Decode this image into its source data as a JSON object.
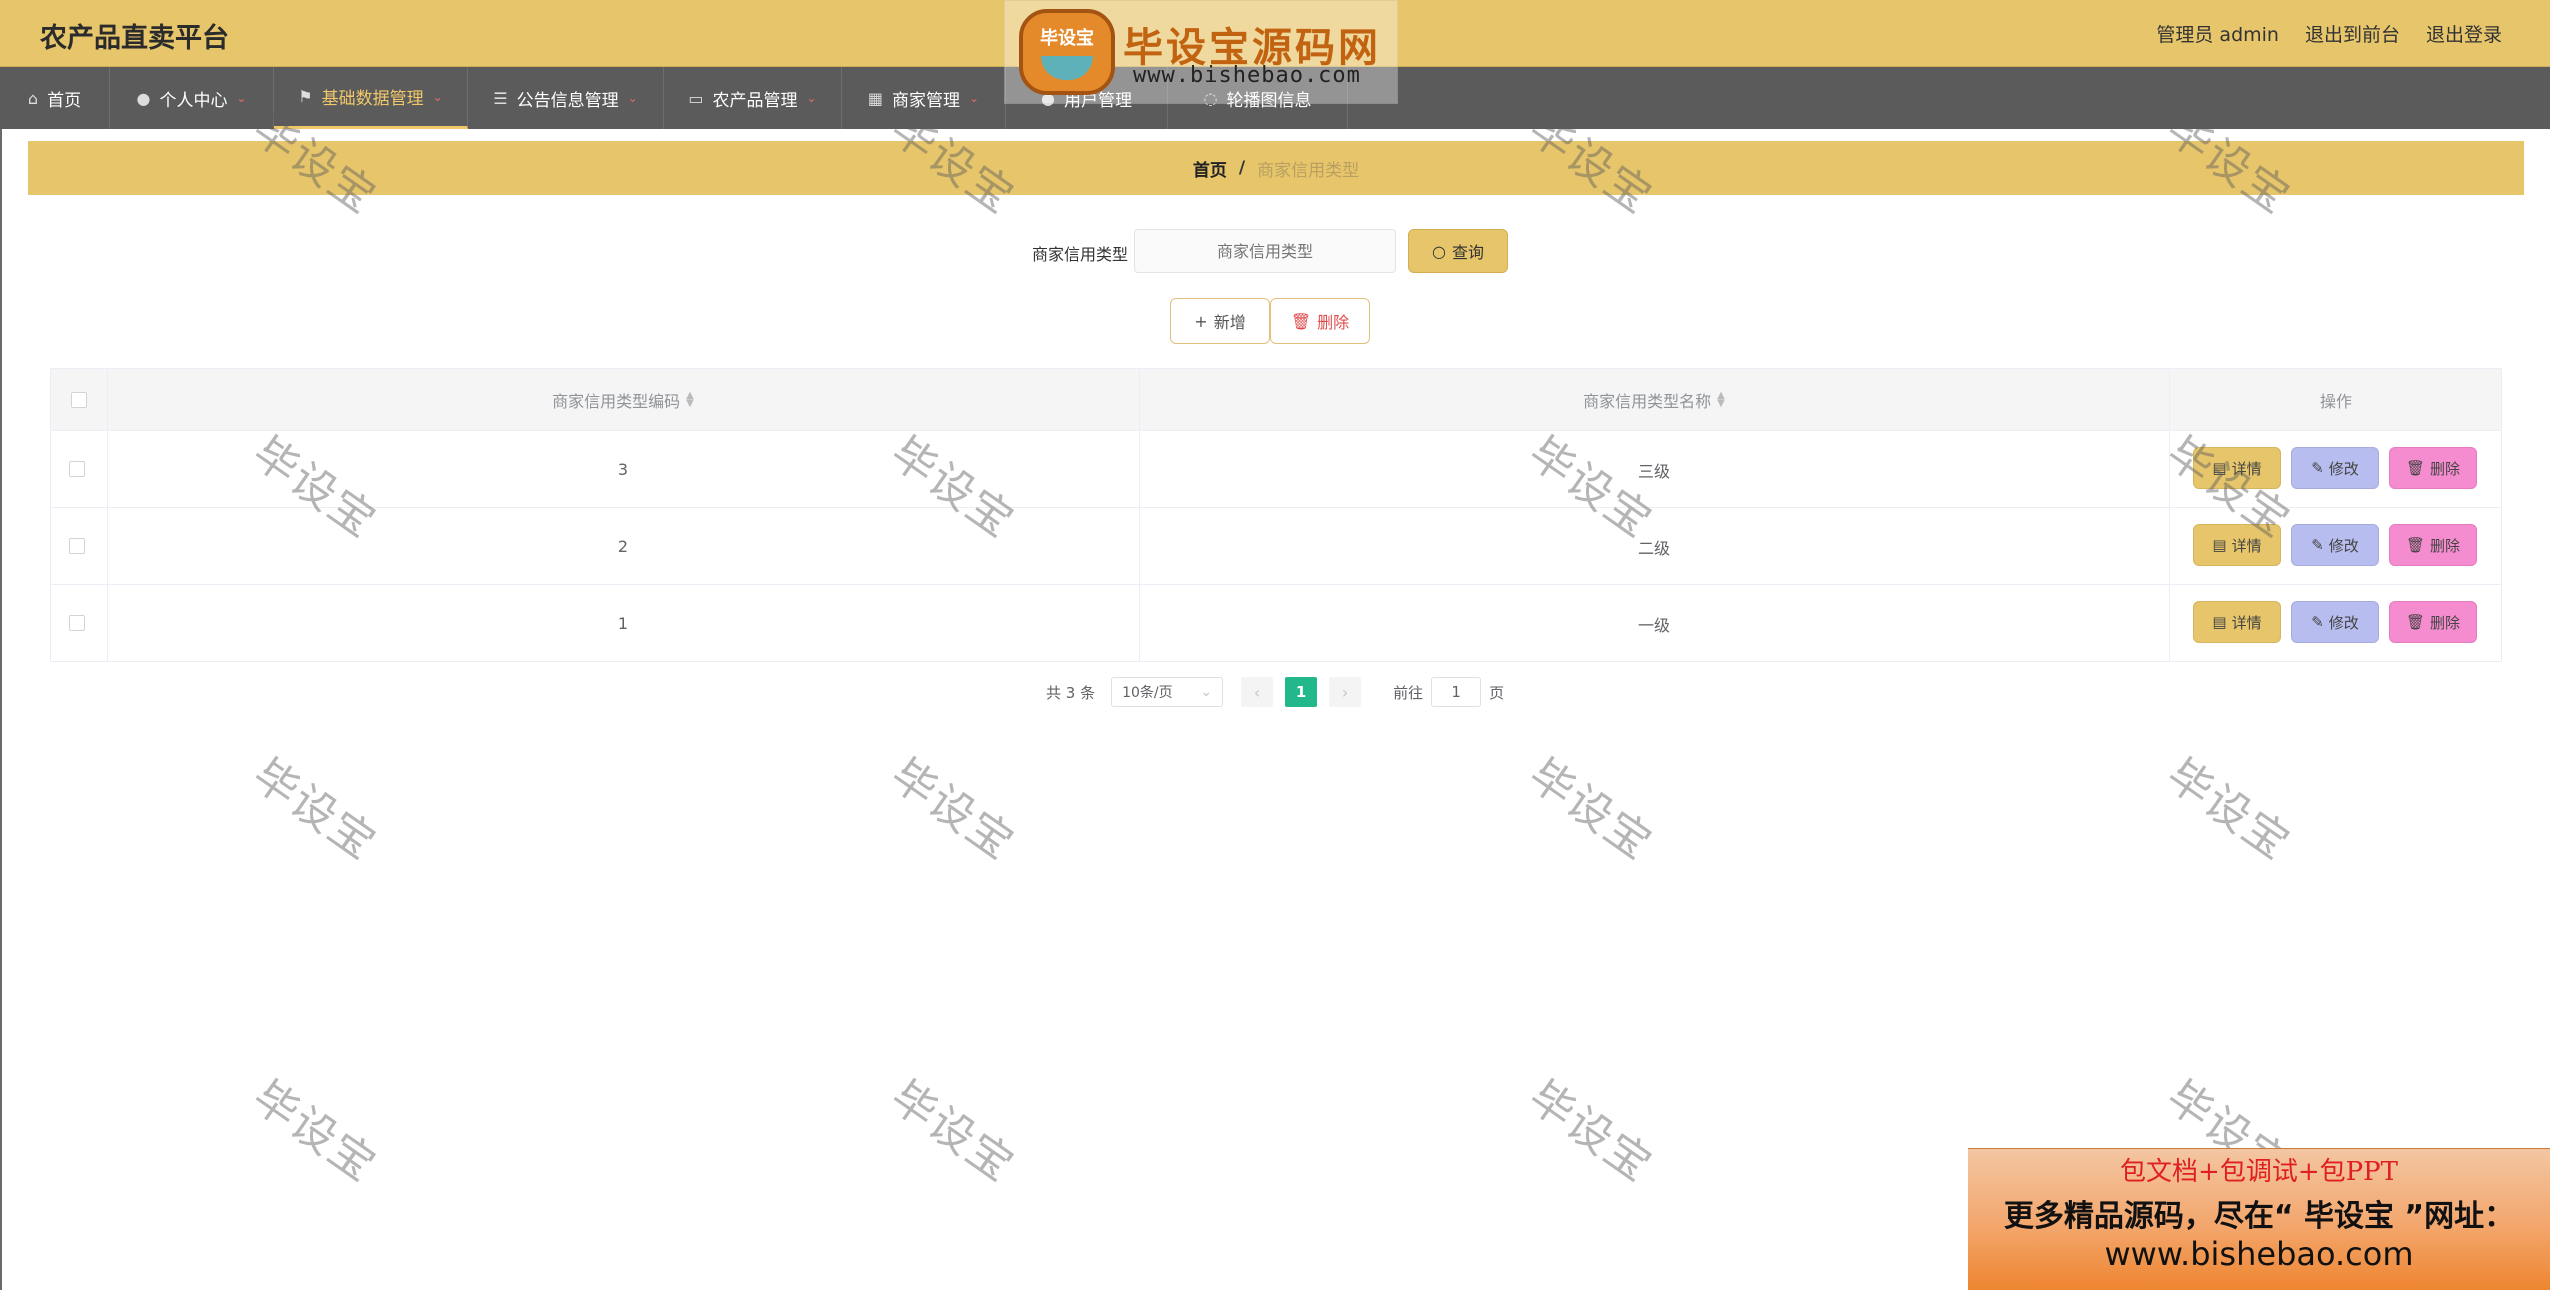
{
  "app": {
    "title": "农产品直卖平台"
  },
  "top_right": {
    "user_label": "管理员 admin",
    "front_link": "退出到前台",
    "logout_link": "退出登录"
  },
  "nav": {
    "items": [
      {
        "label": "首页",
        "icon": "home-icon",
        "active": false
      },
      {
        "label": "个人中心",
        "icon": "user-icon",
        "active": false
      },
      {
        "label": "基础数据管理",
        "icon": "flag-icon",
        "active": true
      },
      {
        "label": "公告信息管理",
        "icon": "sliders-icon",
        "active": false
      },
      {
        "label": "农产品管理",
        "icon": "chat-icon",
        "active": false
      },
      {
        "label": "商家管理",
        "icon": "grid-icon",
        "active": false
      },
      {
        "label": "用户管理",
        "icon": "user-group-icon",
        "active": false
      },
      {
        "label": "轮播图信息",
        "icon": "info-icon",
        "active": false
      }
    ]
  },
  "logo_overlay": {
    "mascot_text": "毕设宝",
    "title": "毕设宝源码网",
    "url": "www.bishebao.com"
  },
  "breadcrumb": {
    "home": "首页",
    "separator": "/",
    "current": "商家信用类型"
  },
  "search": {
    "label": "商家信用类型",
    "placeholder": "商家信用类型",
    "query_button": "查询"
  },
  "toolbar": {
    "add_label": "新增",
    "delete_label": "删除"
  },
  "table": {
    "columns": [
      "商家信用类型编码",
      "商家信用类型名称",
      "操作"
    ],
    "rows": [
      {
        "code": "3",
        "name": "三级"
      },
      {
        "code": "2",
        "name": "二级"
      },
      {
        "code": "1",
        "name": "一级"
      }
    ],
    "actions": {
      "detail": "详情",
      "edit": "修改",
      "delete": "删除"
    }
  },
  "pagination": {
    "total": "共 3 条",
    "page_size": "10条/页",
    "current_page": "1",
    "goto_label": "前往",
    "goto_value": "1",
    "page_suffix": "页"
  },
  "watermark": {
    "text": "毕设宝"
  },
  "promo": {
    "line1": "包文档+包调试+包PPT",
    "line2": "更多精品源码，尽在“ 毕设宝 ”网址：",
    "line3": "www.bishebao.com"
  },
  "colors": {
    "accent": "#e6c56b",
    "nav_bg": "#5b5b5b",
    "pager_active": "#22b88b",
    "edit_btn": "#b8bdef",
    "delete_btn": "#f58ccf"
  }
}
